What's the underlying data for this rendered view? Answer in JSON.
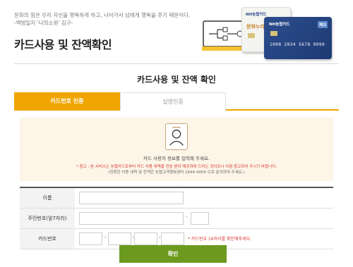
{
  "header": {
    "quote_line1": "문화의 힘은 우리 자신을 행복하게 하고, 나아가서 남에게 행복을 주기 때문이다.",
    "quote_line2": "-백범일지 '나의소원' 김구-",
    "title": "카드사용 및 잔액확인"
  },
  "hero": {
    "card1_brand": "NH농협카드",
    "card1_label": "문화누리",
    "card2_brand": "NH농협카드",
    "card2_number": "1000 2034 5678 9999",
    "badge": "체크"
  },
  "section_title": "카드사용 및 잔액 확인",
  "tabs": [
    {
      "label": "카드번호 인증",
      "active": true
    },
    {
      "label": "실명인증",
      "active": false
    }
  ],
  "info": {
    "main": "카드 사용자 정보를 입력해 주세요.",
    "note_prefix": "* 참고 :",
    "note_line1": " 본 서비스는 농협카드로부터 카드 사용 내역을 전송 받아 제공하여 드리는 것이오니 이점 참고하여 주시기 바랍니다.",
    "note_line2": "(정확한 이용 내역 및 잔액은 농협고객행복센터 1644-4000 으로 문의하여 주세요.)"
  },
  "form": {
    "name_label": "이름",
    "rrn_label": "주민번호(앞7자리)",
    "card_label": "카드번호",
    "dash": "-",
    "card_help": "* 카드번호 16자리를 확인해주세요."
  },
  "confirm_label": "확인",
  "colors": {
    "accent": "#f0a500",
    "button": "#6b9a1f",
    "info_bg": "#fcf5e8",
    "warning": "#d9342b"
  }
}
